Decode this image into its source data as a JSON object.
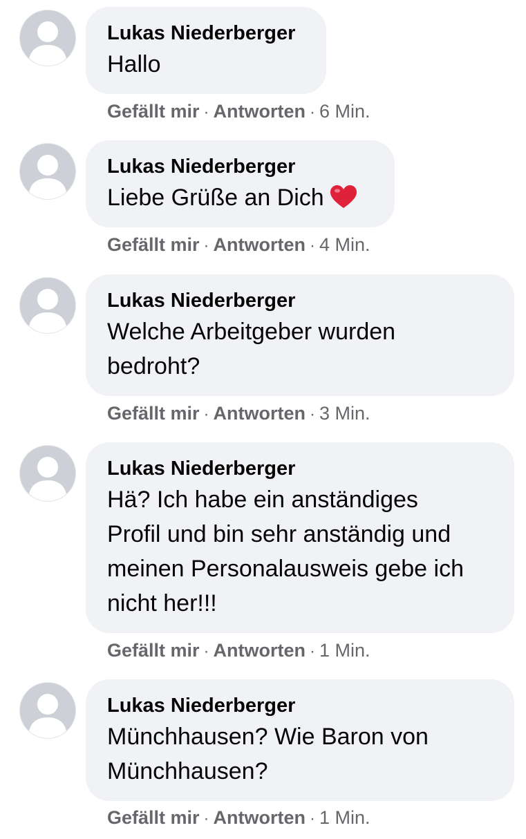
{
  "comments": [
    {
      "author": "Lukas Niederberger",
      "lines": [
        "Hallo"
      ],
      "has_heart": false,
      "like_label": "Gefällt mir",
      "reply_label": "Antworten",
      "separator": "·",
      "time": "6 Min."
    },
    {
      "author": "Lukas Niederberger",
      "lines": [
        "Liebe Grüße an Dich"
      ],
      "has_heart": true,
      "like_label": "Gefällt mir",
      "reply_label": "Antworten",
      "separator": "·",
      "time": "4 Min."
    },
    {
      "author": "Lukas Niederberger",
      "lines": [
        "Welche Arbeitgeber wurden",
        "bedroht?"
      ],
      "has_heart": false,
      "like_label": "Gefällt mir",
      "reply_label": "Antworten",
      "separator": "·",
      "time": "3 Min."
    },
    {
      "author": "Lukas Niederberger",
      "lines": [
        "Hä? Ich habe ein anständiges",
        "Profil und bin sehr anständig und",
        "meinen Personalausweis gebe ich",
        "nicht her!!!"
      ],
      "has_heart": false,
      "like_label": "Gefällt mir",
      "reply_label": "Antworten",
      "separator": "·",
      "time": "1 Min."
    },
    {
      "author": "Lukas Niederberger",
      "lines": [
        "Münchhausen? Wie Baron von",
        "Münchhausen?"
      ],
      "has_heart": false,
      "like_label": "Gefällt mir",
      "reply_label": "Antworten",
      "separator": "·",
      "time": "1 Min."
    }
  ],
  "icons": {
    "avatar": "default-profile-avatar-icon",
    "heart": "red-heart-emoji-icon"
  },
  "colors": {
    "bubble_background": "#f0f2f5",
    "meta_text": "#65676b",
    "heart": "#e0213a"
  }
}
